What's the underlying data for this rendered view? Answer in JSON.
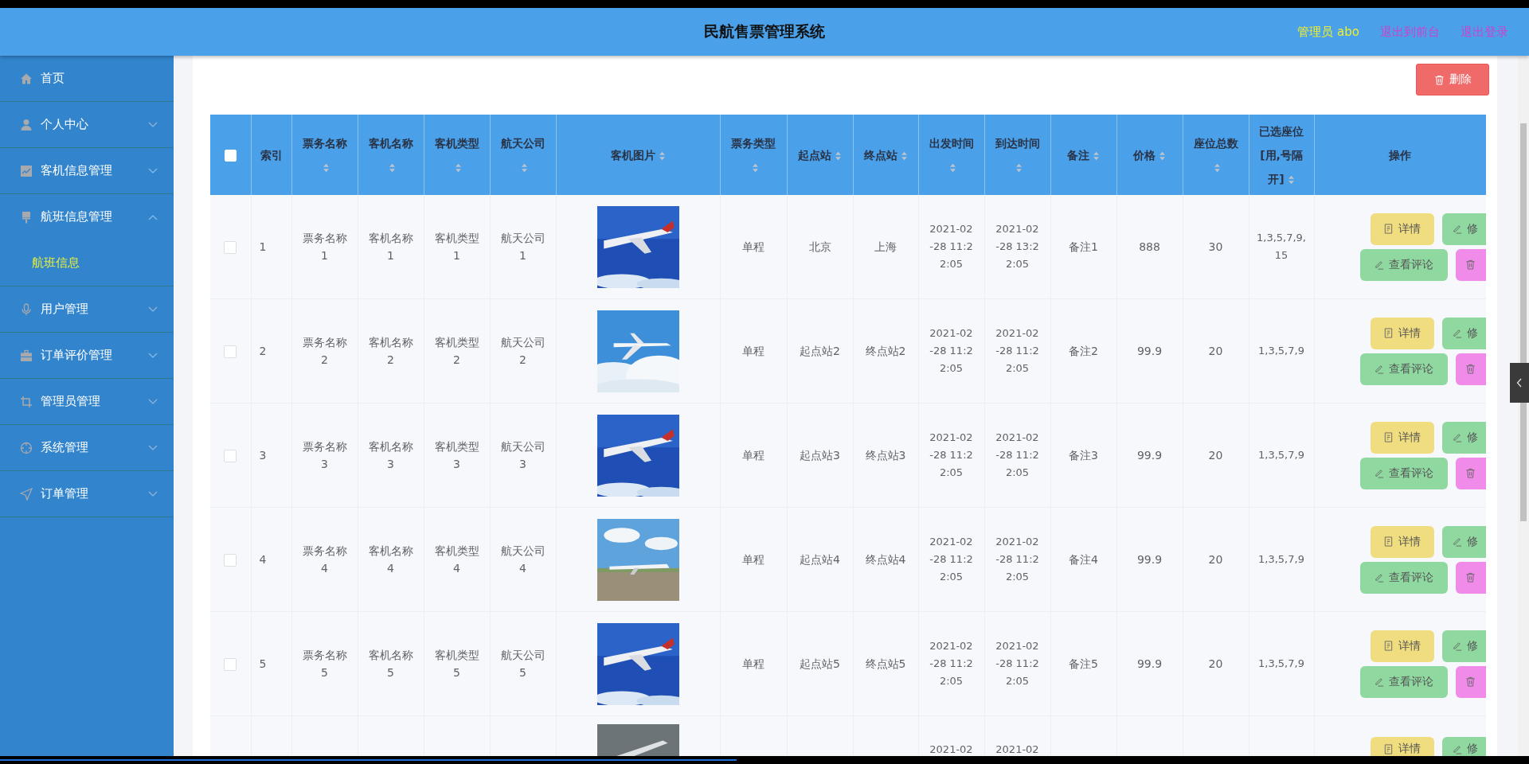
{
  "header": {
    "title": "民航售票管理系统",
    "user": "管理员 abo",
    "links": [
      "退出到前台",
      "退出登录"
    ]
  },
  "sidebar": {
    "items": [
      {
        "label": "首页"
      },
      {
        "label": "个人中心",
        "expanded": false
      },
      {
        "label": "客机信息管理",
        "expanded": false
      },
      {
        "label": "航班信息管理",
        "expanded": true,
        "children": [
          {
            "label": "航班信息",
            "selected": true
          }
        ]
      },
      {
        "label": "用户管理",
        "expanded": false
      },
      {
        "label": "订单评价管理",
        "expanded": false
      },
      {
        "label": "管理员管理",
        "expanded": false
      },
      {
        "label": "系统管理",
        "expanded": false
      },
      {
        "label": "订单管理",
        "expanded": false
      }
    ]
  },
  "toolbar": {
    "delete_button": "删除"
  },
  "table": {
    "select_all": {
      "checked": false
    },
    "columns": [
      {
        "label": "索引",
        "sortable": false
      },
      {
        "label": "票务名称",
        "sortable": true
      },
      {
        "label": "客机名称",
        "sortable": true
      },
      {
        "label": "客机类型",
        "sortable": true
      },
      {
        "label": "航天公司",
        "sortable": true
      },
      {
        "label": "客机图片",
        "sortable": true
      },
      {
        "label": "票务类型",
        "sortable": true
      },
      {
        "label": "起点站",
        "sortable": true
      },
      {
        "label": "终点站",
        "sortable": true
      },
      {
        "label": "出发时间",
        "sortable": true
      },
      {
        "label": "到达时间",
        "sortable": true
      },
      {
        "label": "备注",
        "sortable": true
      },
      {
        "label": "价格",
        "sortable": true
      },
      {
        "label": "座位总数",
        "sortable": true
      },
      {
        "label": "已选座位[用,号隔开]",
        "sortable": true
      },
      {
        "label": "操作",
        "sortable": false
      }
    ],
    "rows": [
      {
        "checked": false,
        "cells": [
          "1",
          "票务名称1",
          "客机名称1",
          "客机类型1",
          "航天公司1",
          {
            "kind": "picture"
          },
          "单程",
          "北京",
          "上海",
          "2021-02-28 11:22:05",
          "2021-02-28 13:22:05",
          "备注1",
          "888",
          "30",
          "1,3,5,7,9,15"
        ],
        "actions": [
          {
            "kind": "detail",
            "label": "详情"
          },
          {
            "kind": "edit",
            "label": "修"
          },
          {
            "kind": "comment",
            "label": "查看评论"
          },
          {
            "kind": "delete"
          }
        ]
      },
      {
        "checked": false,
        "cells": [
          "2",
          "票务名称2",
          "客机名称2",
          "客机类型2",
          "航天公司2",
          {
            "kind": "picture"
          },
          "单程",
          "起点站2",
          "终点站2",
          "2021-02-28 11:22:05",
          "2021-02-28 11:22:05",
          "备注2",
          "99.9",
          "20",
          "1,3,5,7,9"
        ],
        "actions": [
          {
            "kind": "detail",
            "label": "详情"
          },
          {
            "kind": "edit",
            "label": "修"
          },
          {
            "kind": "comment",
            "label": "查看评论"
          },
          {
            "kind": "delete"
          }
        ]
      },
      {
        "checked": false,
        "cells": [
          "3",
          "票务名称3",
          "客机名称3",
          "客机类型3",
          "航天公司3",
          {
            "kind": "picture"
          },
          "单程",
          "起点站3",
          "终点站3",
          "2021-02-28 11:22:05",
          "2021-02-28 11:22:05",
          "备注3",
          "99.9",
          "20",
          "1,3,5,7,9"
        ],
        "actions": [
          {
            "kind": "detail",
            "label": "详情"
          },
          {
            "kind": "edit",
            "label": "修"
          },
          {
            "kind": "comment",
            "label": "查看评论"
          },
          {
            "kind": "delete"
          }
        ]
      },
      {
        "checked": false,
        "cells": [
          "4",
          "票务名称4",
          "客机名称4",
          "客机类型4",
          "航天公司4",
          {
            "kind": "picture"
          },
          "单程",
          "起点站4",
          "终点站4",
          "2021-02-28 11:22:05",
          "2021-02-28 11:22:05",
          "备注4",
          "99.9",
          "20",
          "1,3,5,7,9"
        ],
        "actions": [
          {
            "kind": "detail",
            "label": "详情"
          },
          {
            "kind": "edit",
            "label": "修"
          },
          {
            "kind": "comment",
            "label": "查看评论"
          },
          {
            "kind": "delete"
          }
        ]
      },
      {
        "checked": false,
        "cells": [
          "5",
          "票务名称5",
          "客机名称5",
          "客机类型5",
          "航天公司5",
          {
            "kind": "picture"
          },
          "单程",
          "起点站5",
          "终点站5",
          "2021-02-28 11:22:05",
          "2021-02-28 11:22:05",
          "备注5",
          "99.9",
          "20",
          "1,3,5,7,9"
        ],
        "actions": [
          {
            "kind": "detail",
            "label": "详情"
          },
          {
            "kind": "edit",
            "label": "修"
          },
          {
            "kind": "comment",
            "label": "查看评论"
          },
          {
            "kind": "delete"
          }
        ]
      },
      {
        "cells": [
          "",
          "",
          "",
          "",
          "",
          {
            "kind": "picture"
          },
          "",
          "",
          "",
          "2021-02",
          "2021-02",
          "",
          "",
          "",
          ""
        ],
        "actions": [
          {
            "kind": "detail",
            "label": "详情"
          },
          {
            "kind": "edit",
            "label": "修"
          }
        ]
      }
    ]
  }
}
